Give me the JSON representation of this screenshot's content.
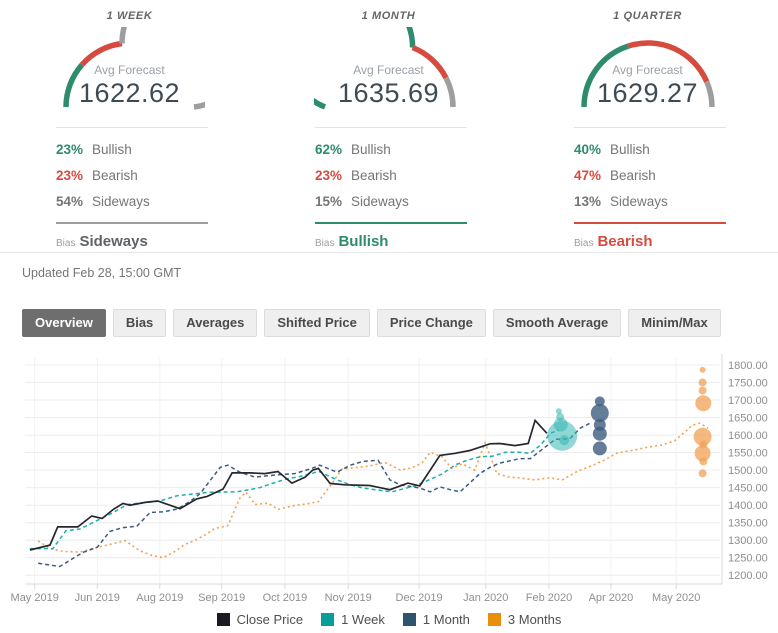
{
  "colors": {
    "bullish": "#2E8B6E",
    "bearish": "#D74B3F",
    "sideways": "#9E9E9E",
    "pct_sideways": "#757575",
    "bias_sideways_text": "#5F6368",
    "grid_h": "#ececec",
    "grid_v": "#f1f1f1",
    "axis": "#d9d9d9",
    "tick_text": "#8f8f8f"
  },
  "forecast_panels": [
    {
      "period": "1 WEEK",
      "avg_label": "Avg Forecast",
      "avg_value": "1622.62",
      "gauge": {
        "bullish": 23,
        "bearish": 23,
        "sideways": 54
      },
      "rows": [
        {
          "pct": "23%",
          "label": "Bullish",
          "type": "bullish"
        },
        {
          "pct": "23%",
          "label": "Bearish",
          "type": "bearish"
        },
        {
          "pct": "54%",
          "label": "Sideways",
          "type": "sideways"
        }
      ],
      "bias_label": "Bias",
      "bias": {
        "label": "Sideways",
        "type": "sideways"
      }
    },
    {
      "period": "1 MONTH",
      "avg_label": "Avg Forecast",
      "avg_value": "1635.69",
      "gauge": {
        "bullish": 62,
        "bearish": 23,
        "sideways": 15
      },
      "rows": [
        {
          "pct": "62%",
          "label": "Bullish",
          "type": "bullish"
        },
        {
          "pct": "23%",
          "label": "Bearish",
          "type": "bearish"
        },
        {
          "pct": "15%",
          "label": "Sideways",
          "type": "sideways"
        }
      ],
      "bias_label": "Bias",
      "bias": {
        "label": "Bullish",
        "type": "bullish"
      }
    },
    {
      "period": "1 QUARTER",
      "avg_label": "Avg Forecast",
      "avg_value": "1629.27",
      "gauge": {
        "bullish": 40,
        "bearish": 47,
        "sideways": 13
      },
      "rows": [
        {
          "pct": "40%",
          "label": "Bullish",
          "type": "bullish"
        },
        {
          "pct": "47%",
          "label": "Bearish",
          "type": "bearish"
        },
        {
          "pct": "13%",
          "label": "Sideways",
          "type": "sideways"
        }
      ],
      "bias_label": "Bias",
      "bias": {
        "label": "Bearish",
        "type": "bearish"
      }
    }
  ],
  "updated": "Updated Feb 28, 15:00 GMT",
  "tabs": [
    {
      "label": "Overview",
      "active": true
    },
    {
      "label": "Bias",
      "active": false
    },
    {
      "label": "Averages",
      "active": false
    },
    {
      "label": "Shifted Price",
      "active": false
    },
    {
      "label": "Price Change",
      "active": false
    },
    {
      "label": "Smooth Average",
      "active": false
    },
    {
      "label": "Minim/Max",
      "active": false
    }
  ],
  "chart_data": {
    "type": "line",
    "title": "",
    "xlabel": "",
    "ylabel": "",
    "x_unit": "fraction of plot width (time, weekly, May 2019 - May 2020)",
    "ylim": [
      1175,
      1820
    ],
    "grid": true,
    "y_ticks": [
      {
        "v": 1800,
        "label": "1800.00"
      },
      {
        "v": 1750,
        "label": "1750.00"
      },
      {
        "v": 1700,
        "label": "1700.00"
      },
      {
        "v": 1650,
        "label": "1650.00"
      },
      {
        "v": 1600,
        "label": "1600.00"
      },
      {
        "v": 1550,
        "label": "1550.00"
      },
      {
        "v": 1500,
        "label": "1500.00"
      },
      {
        "v": 1450,
        "label": "1450.00"
      },
      {
        "v": 1400,
        "label": "1400.00"
      },
      {
        "v": 1350,
        "label": "1350.00"
      },
      {
        "v": 1300,
        "label": "1300.00"
      },
      {
        "v": 1250,
        "label": "1250.00"
      },
      {
        "v": 1200,
        "label": "1200.00"
      }
    ],
    "x_ticks": [
      {
        "f": 0.014,
        "label": "May 2019"
      },
      {
        "f": 0.104,
        "label": "Jun 2019"
      },
      {
        "f": 0.194,
        "label": "Aug 2019"
      },
      {
        "f": 0.283,
        "label": "Sep 2019"
      },
      {
        "f": 0.374,
        "label": "Oct 2019"
      },
      {
        "f": 0.465,
        "label": "Nov 2019"
      },
      {
        "f": 0.567,
        "label": "Dec 2019"
      },
      {
        "f": 0.663,
        "label": "Jan 2020"
      },
      {
        "f": 0.754,
        "label": "Feb 2020"
      },
      {
        "f": 0.843,
        "label": "Apr 2020"
      },
      {
        "f": 0.937,
        "label": "May 2020"
      }
    ],
    "series": [
      {
        "name": "Close Price",
        "color": "#26262e",
        "style": "solid",
        "width": 1.7,
        "points": [
          [
            0.007,
            1272
          ],
          [
            0.036,
            1286
          ],
          [
            0.047,
            1338
          ],
          [
            0.076,
            1338
          ],
          [
            0.096,
            1369
          ],
          [
            0.111,
            1362
          ],
          [
            0.127,
            1388
          ],
          [
            0.141,
            1405
          ],
          [
            0.151,
            1400
          ],
          [
            0.173,
            1408
          ],
          [
            0.191,
            1412
          ],
          [
            0.223,
            1390
          ],
          [
            0.247,
            1418
          ],
          [
            0.262,
            1425
          ],
          [
            0.285,
            1446
          ],
          [
            0.298,
            1492
          ],
          [
            0.324,
            1492
          ],
          [
            0.345,
            1490
          ],
          [
            0.364,
            1496
          ],
          [
            0.384,
            1463
          ],
          [
            0.403,
            1480
          ],
          [
            0.414,
            1500
          ],
          [
            0.422,
            1505
          ],
          [
            0.439,
            1462
          ],
          [
            0.46,
            1458
          ],
          [
            0.496,
            1456
          ],
          [
            0.525,
            1444
          ],
          [
            0.551,
            1463
          ],
          [
            0.568,
            1455
          ],
          [
            0.597,
            1542
          ],
          [
            0.619,
            1548
          ],
          [
            0.64,
            1556
          ],
          [
            0.669,
            1575
          ],
          [
            0.683,
            1576
          ],
          [
            0.705,
            1570
          ],
          [
            0.724,
            1576
          ],
          [
            0.734,
            1642
          ],
          [
            0.751,
            1605
          ]
        ]
      },
      {
        "name": "1 Week",
        "color": "#1FAFAA",
        "style": "dashed",
        "width": 1.5,
        "points": [
          [
            0.007,
            1276
          ],
          [
            0.04,
            1276
          ],
          [
            0.059,
            1327
          ],
          [
            0.079,
            1332
          ],
          [
            0.127,
            1379
          ],
          [
            0.147,
            1402
          ],
          [
            0.161,
            1405
          ],
          [
            0.194,
            1412
          ],
          [
            0.219,
            1427
          ],
          [
            0.266,
            1437
          ],
          [
            0.305,
            1438
          ],
          [
            0.328,
            1446
          ],
          [
            0.338,
            1450
          ],
          [
            0.357,
            1463
          ],
          [
            0.377,
            1475
          ],
          [
            0.396,
            1482
          ],
          [
            0.414,
            1491
          ],
          [
            0.422,
            1497
          ],
          [
            0.449,
            1472
          ],
          [
            0.468,
            1458
          ],
          [
            0.486,
            1449
          ],
          [
            0.508,
            1443
          ],
          [
            0.528,
            1438
          ],
          [
            0.561,
            1455
          ],
          [
            0.587,
            1477
          ],
          [
            0.601,
            1490
          ],
          [
            0.619,
            1515
          ],
          [
            0.636,
            1528
          ],
          [
            0.655,
            1538
          ],
          [
            0.673,
            1540
          ],
          [
            0.691,
            1551
          ],
          [
            0.712,
            1551
          ],
          [
            0.727,
            1548
          ],
          [
            0.742,
            1572
          ],
          [
            0.756,
            1605
          ],
          [
            0.768,
            1614
          ]
        ]
      },
      {
        "name": "1 Month",
        "color": "#3A5C80",
        "style": "dashed",
        "width": 1.5,
        "points": [
          [
            0.019,
            1234
          ],
          [
            0.05,
            1225
          ],
          [
            0.083,
            1265
          ],
          [
            0.104,
            1280
          ],
          [
            0.122,
            1325
          ],
          [
            0.141,
            1336
          ],
          [
            0.161,
            1340
          ],
          [
            0.18,
            1379
          ],
          [
            0.199,
            1381
          ],
          [
            0.219,
            1389
          ],
          [
            0.237,
            1410
          ],
          [
            0.252,
            1433
          ],
          [
            0.281,
            1508
          ],
          [
            0.292,
            1514
          ],
          [
            0.309,
            1494
          ],
          [
            0.331,
            1480
          ],
          [
            0.36,
            1486
          ],
          [
            0.388,
            1490
          ],
          [
            0.413,
            1505
          ],
          [
            0.424,
            1514
          ],
          [
            0.449,
            1494
          ],
          [
            0.468,
            1514
          ],
          [
            0.486,
            1525
          ],
          [
            0.508,
            1528
          ],
          [
            0.525,
            1472
          ],
          [
            0.54,
            1458
          ],
          [
            0.568,
            1449
          ],
          [
            0.583,
            1438
          ],
          [
            0.597,
            1452
          ],
          [
            0.612,
            1444
          ],
          [
            0.626,
            1438
          ],
          [
            0.655,
            1491
          ],
          [
            0.669,
            1508
          ],
          [
            0.683,
            1520
          ],
          [
            0.712,
            1533
          ],
          [
            0.727,
            1533
          ],
          [
            0.748,
            1565
          ],
          [
            0.763,
            1588
          ],
          [
            0.784,
            1590
          ],
          [
            0.799,
            1620
          ],
          [
            0.813,
            1634
          ]
        ]
      },
      {
        "name": "3 Months",
        "color": "#F2A050",
        "style": "dotted",
        "width": 1.6,
        "points": [
          [
            0.019,
            1298
          ],
          [
            0.036,
            1276
          ],
          [
            0.055,
            1268
          ],
          [
            0.079,
            1266
          ],
          [
            0.101,
            1278
          ],
          [
            0.122,
            1288
          ],
          [
            0.144,
            1299
          ],
          [
            0.165,
            1270
          ],
          [
            0.183,
            1256
          ],
          [
            0.199,
            1250
          ],
          [
            0.216,
            1268
          ],
          [
            0.23,
            1288
          ],
          [
            0.245,
            1300
          ],
          [
            0.259,
            1315
          ],
          [
            0.273,
            1333
          ],
          [
            0.292,
            1342
          ],
          [
            0.309,
            1420
          ],
          [
            0.318,
            1437
          ],
          [
            0.331,
            1402
          ],
          [
            0.35,
            1406
          ],
          [
            0.364,
            1388
          ],
          [
            0.384,
            1398
          ],
          [
            0.403,
            1403
          ],
          [
            0.422,
            1410
          ],
          [
            0.439,
            1455
          ],
          [
            0.456,
            1503
          ],
          [
            0.475,
            1507
          ],
          [
            0.496,
            1512
          ],
          [
            0.518,
            1522
          ],
          [
            0.54,
            1500
          ],
          [
            0.557,
            1507
          ],
          [
            0.571,
            1520
          ],
          [
            0.583,
            1551
          ],
          [
            0.6,
            1538
          ],
          [
            0.614,
            1505
          ],
          [
            0.629,
            1518
          ],
          [
            0.647,
            1500
          ],
          [
            0.662,
            1578
          ],
          [
            0.679,
            1490
          ],
          [
            0.695,
            1481
          ],
          [
            0.715,
            1477
          ],
          [
            0.734,
            1472
          ],
          [
            0.755,
            1478
          ],
          [
            0.773,
            1472
          ],
          [
            0.796,
            1498
          ],
          [
            0.816,
            1513
          ],
          [
            0.835,
            1530
          ],
          [
            0.852,
            1549
          ],
          [
            0.873,
            1556
          ],
          [
            0.892,
            1564
          ],
          [
            0.917,
            1572
          ],
          [
            0.935,
            1584
          ],
          [
            0.96,
            1628
          ],
          [
            0.971,
            1634
          ],
          [
            0.983,
            1620
          ]
        ]
      }
    ],
    "bubbles": [
      {
        "series": "1 Week",
        "fill": "#36B7B3",
        "opacity": 0.55,
        "points": [
          [
            0.773,
            1598,
            15
          ],
          [
            0.771,
            1630,
            7
          ],
          [
            0.77,
            1652,
            4
          ],
          [
            0.768,
            1668,
            3
          ],
          [
            0.776,
            1585,
            5
          ]
        ]
      },
      {
        "series": "1 Month",
        "fill": "#3D5C80",
        "opacity": 0.8,
        "points": [
          [
            0.827,
            1696,
            5
          ],
          [
            0.827,
            1663,
            9
          ],
          [
            0.827,
            1629,
            6
          ],
          [
            0.827,
            1604,
            7
          ],
          [
            0.827,
            1562,
            7
          ]
        ]
      },
      {
        "series": "3 Months",
        "fill": "#F2A256",
        "opacity": 0.75,
        "points": [
          [
            0.975,
            1786,
            3
          ],
          [
            0.975,
            1750,
            4
          ],
          [
            0.975,
            1727,
            4
          ],
          [
            0.976,
            1691,
            8
          ],
          [
            0.975,
            1595,
            9
          ],
          [
            0.976,
            1573,
            4
          ],
          [
            0.975,
            1548,
            8
          ],
          [
            0.976,
            1525,
            4
          ],
          [
            0.975,
            1491,
            4
          ]
        ]
      }
    ],
    "legend": [
      {
        "label": "Close Price",
        "color": "#1a1a24"
      },
      {
        "label": "1 Week",
        "color": "#089E9A"
      },
      {
        "label": "1 Month",
        "color": "#2F5470"
      },
      {
        "label": "3 Months",
        "color": "#E8900C"
      }
    ],
    "legend_position": "bottom-center"
  }
}
